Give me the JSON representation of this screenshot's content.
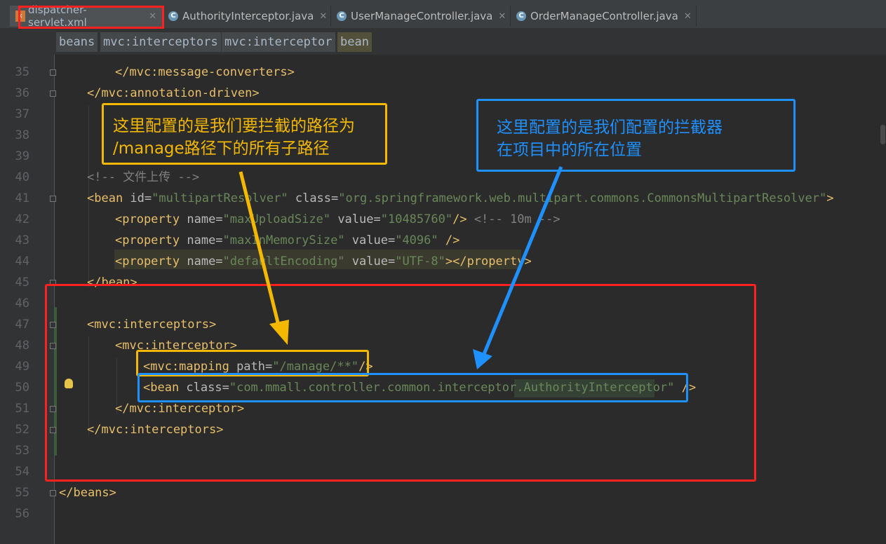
{
  "tabs": [
    {
      "label": "dispatcher-servlet.xml",
      "icon": "xml-file-icon",
      "active": true
    },
    {
      "label": "AuthorityInterceptor.java",
      "icon": "java-class-icon",
      "active": false
    },
    {
      "label": "UserManageController.java",
      "icon": "java-class-icon",
      "active": false
    },
    {
      "label": "OrderManageController.java",
      "icon": "java-class-icon",
      "active": false
    }
  ],
  "breadcrumb": [
    "beans",
    "mvc:interceptors",
    "mvc:interceptor",
    "bean"
  ],
  "line_numbers": [
    "35",
    "36",
    "37",
    "38",
    "39",
    "40",
    "41",
    "42",
    "43",
    "44",
    "45",
    "46",
    "47",
    "48",
    "49",
    "50",
    "51",
    "52",
    "53",
    "54",
    "55",
    "56"
  ],
  "code": {
    "l35": "</mvc:message-converters>",
    "l36": "</mvc:annotation-driven>",
    "l40": "<!-- 文件上传 -->",
    "l41": {
      "open": "<bean ",
      "a1": "id=",
      "v1": "\"multipartResolver\"",
      "a2": " class=",
      "v2": "\"org.springframework.web.multipart.commons.CommonsMultipartResolver\"",
      "close": ">"
    },
    "l42": {
      "open": "<property ",
      "a1": "name=",
      "v1": "\"maxUploadSize\"",
      "a2": " value=",
      "v2": "\"10485760\"",
      "close": "/>",
      "comment": " <!-- 10m -->"
    },
    "l43": {
      "open": "<property ",
      "a1": "name=",
      "v1": "\"maxInMemorySize\"",
      "a2": " value=",
      "v2": "\"4096\"",
      "close": " />"
    },
    "l44": {
      "open": "<property ",
      "a1": "name=",
      "v1": "\"defaultEncoding\"",
      "a2": " value=",
      "v2": "\"UTF-8\"",
      "close": "></property>"
    },
    "l45": "</bean>",
    "l47": "<mvc:interceptors>",
    "l48": "<mvc:interceptor>",
    "l49": {
      "open": "<mvc:mapping ",
      "a1": "path=",
      "v1": "\"/manage/**\"",
      "close": "/>"
    },
    "l50": {
      "open": "<bean ",
      "a1": "class=",
      "v1": "\"com.mmall.controller.common.interceptor.AuthorityInterceptor\"",
      "close": " />"
    },
    "l51": "</mvc:interceptor>",
    "l52": "</mvc:interceptors>",
    "l55": "</beans>"
  },
  "annotations": {
    "yellow_note": "这里配置的是我们要拦截的路径为\n/manage路径下的所有子路径",
    "blue_note": "这里配置的是我们配置的拦截器\n在项目中的所在位置"
  },
  "colors": {
    "red": "#ff2020",
    "yellow": "#f5b800",
    "blue": "#1e90ff",
    "tag": "#e8bf6a",
    "attr": "#bababa",
    "value": "#6a8759",
    "comment": "#808080"
  }
}
